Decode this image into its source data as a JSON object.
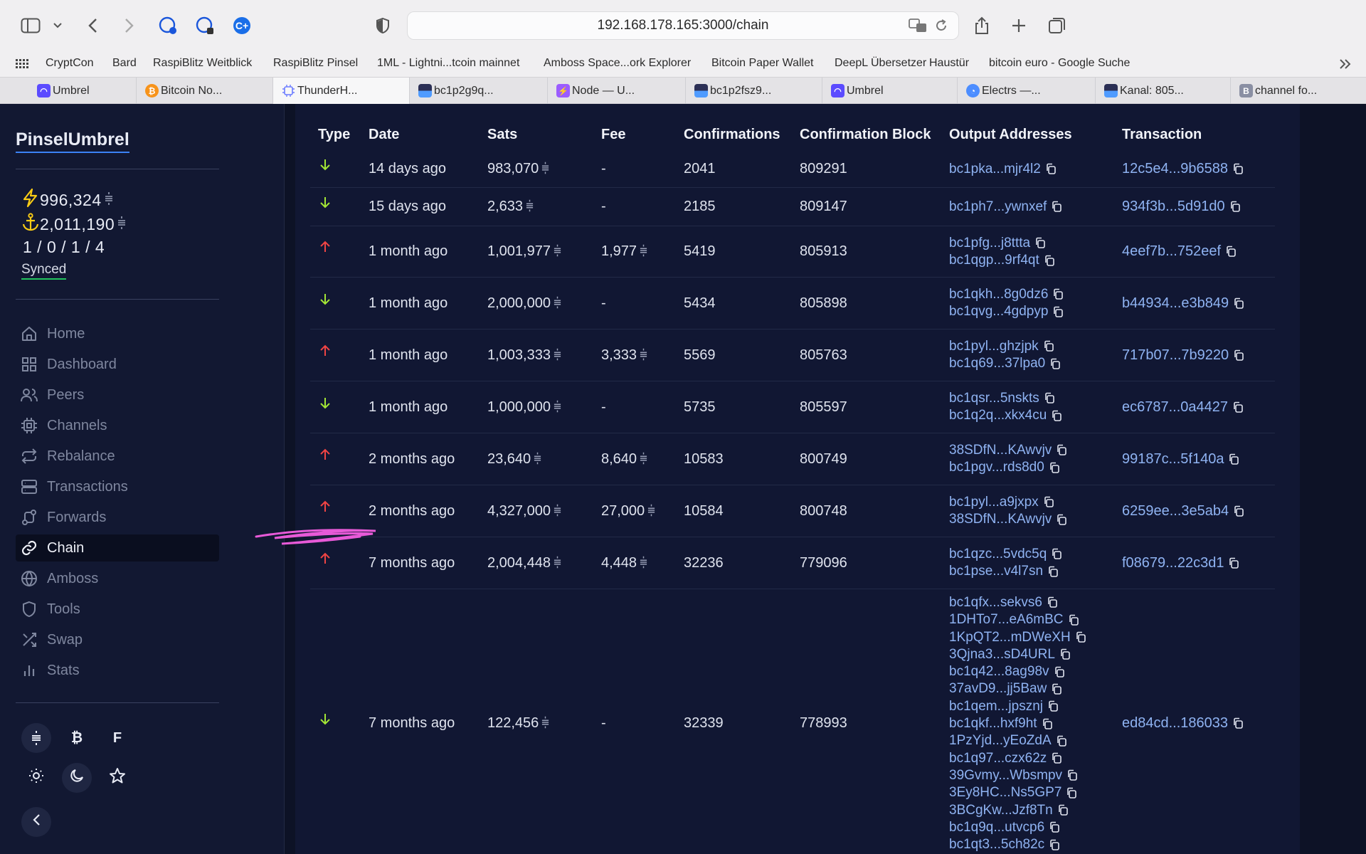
{
  "browser": {
    "url": "192.168.178.165:3000/chain",
    "bookmarks": [
      "CryptCon",
      "Bard",
      "RaspiBlitz Weitblick",
      "RaspiBlitz Pinsel",
      "1ML - Lightni...tcoin mainnet",
      "Amboss Space...ork Explorer",
      "Bitcoin Paper Wallet",
      "DeepL Übersetzer",
      "Haustür",
      "bitcoin euro - Google Suche"
    ],
    "tabs": [
      {
        "label": "Umbrel",
        "icon": "umbrel-icon",
        "color": "#5b4bff"
      },
      {
        "label": "Bitcoin No...",
        "icon": "bitcoin-icon",
        "color": "#f7931a"
      },
      {
        "label": "ThunderH...",
        "icon": "thunderhub-icon",
        "color": "#6b7cff"
      },
      {
        "label": "bc1p2g9q...",
        "icon": "mempool-icon",
        "color": "#3b3f6e"
      },
      {
        "label": "Node — U...",
        "icon": "lightning-icon",
        "color": "#9b5cff"
      },
      {
        "label": "bc1p2fsz9...",
        "icon": "mempool-icon",
        "color": "#3b3f6e"
      },
      {
        "label": "Umbrel",
        "icon": "umbrel-icon",
        "color": "#5b4bff"
      },
      {
        "label": "Electrs —...",
        "icon": "electrs-icon",
        "color": "#4c8dff"
      },
      {
        "label": "Kanal: 805...",
        "icon": "mempool-icon",
        "color": "#3b3f6e"
      },
      {
        "label": "channel fo...",
        "icon": "b-icon",
        "color": "#8a8fa3"
      }
    ]
  },
  "sidebar": {
    "brand": "PinselUmbrel",
    "lightning_balance": "996,324",
    "chain_balance": "2,011,190",
    "channel_counts": "1 / 0 / 1 / 4",
    "sync_status": "Synced",
    "nav": [
      {
        "label": "Home",
        "icon": "home-icon"
      },
      {
        "label": "Dashboard",
        "icon": "dashboard-icon"
      },
      {
        "label": "Peers",
        "icon": "peers-icon"
      },
      {
        "label": "Channels",
        "icon": "channels-icon"
      },
      {
        "label": "Rebalance",
        "icon": "rebalance-icon"
      },
      {
        "label": "Transactions",
        "icon": "transactions-icon"
      },
      {
        "label": "Forwards",
        "icon": "forwards-icon"
      },
      {
        "label": "Chain",
        "icon": "chain-icon",
        "active": true
      },
      {
        "label": "Amboss",
        "icon": "globe-icon"
      },
      {
        "label": "Tools",
        "icon": "shield-icon"
      },
      {
        "label": "Swap",
        "icon": "shuffle-icon"
      },
      {
        "label": "Stats",
        "icon": "bar-chart-icon"
      }
    ],
    "unit_buttons": {
      "sats": "sats",
      "btc": "₿",
      "fiat": "F"
    }
  },
  "table": {
    "headers": {
      "type": "Type",
      "date": "Date",
      "sats": "Sats",
      "fee": "Fee",
      "confirmations": "Confirmations",
      "block": "Confirmation Block",
      "outputs": "Output Addresses",
      "tx": "Transaction"
    },
    "rows": [
      {
        "direction": "in",
        "date": "14 days ago",
        "sats": "983,070",
        "fee": "-",
        "confirmations": "2041",
        "block": "809291",
        "outputs": [
          "bc1pka...mjr4l2"
        ],
        "tx": "12c5e4...9b6588"
      },
      {
        "direction": "in",
        "date": "15 days ago",
        "sats": "2,633",
        "fee": "-",
        "confirmations": "2185",
        "block": "809147",
        "outputs": [
          "bc1ph7...ywnxef"
        ],
        "tx": "934f3b...5d91d0"
      },
      {
        "direction": "out",
        "date": "1 month ago",
        "sats": "1,001,977",
        "fee": "1,977",
        "confirmations": "5419",
        "block": "805913",
        "outputs": [
          "bc1pfg...j8ttta",
          "bc1qgp...9rf4qt"
        ],
        "tx": "4eef7b...752eef"
      },
      {
        "direction": "in",
        "date": "1 month ago",
        "sats": "2,000,000",
        "fee": "-",
        "confirmations": "5434",
        "block": "805898",
        "outputs": [
          "bc1qkh...8g0dz6",
          "bc1qvg...4gdpyp"
        ],
        "tx": "b44934...e3b849"
      },
      {
        "direction": "out",
        "date": "1 month ago",
        "sats": "1,003,333",
        "fee": "3,333",
        "confirmations": "5569",
        "block": "805763",
        "outputs": [
          "bc1pyl...ghzjpk",
          "bc1q69...37lpa0"
        ],
        "tx": "717b07...7b9220"
      },
      {
        "direction": "in",
        "date": "1 month ago",
        "sats": "1,000,000",
        "fee": "-",
        "confirmations": "5735",
        "block": "805597",
        "outputs": [
          "bc1qsr...5nskts",
          "bc1q2q...xkx4cu"
        ],
        "tx": "ec6787...0a4427"
      },
      {
        "direction": "out",
        "date": "2 months ago",
        "sats": "23,640",
        "fee": "8,640",
        "confirmations": "10583",
        "block": "800749",
        "outputs": [
          "38SDfN...KAwvjv",
          "bc1pgv...rds8d0"
        ],
        "tx": "99187c...5f140a"
      },
      {
        "direction": "out",
        "date": "2 months ago",
        "sats": "4,327,000",
        "fee": "27,000",
        "confirmations": "10584",
        "block": "800748",
        "outputs": [
          "bc1pyl...a9jxpx",
          "38SDfN...KAwvjv"
        ],
        "tx": "6259ee...3e5ab4"
      },
      {
        "direction": "out",
        "date": "7 months ago",
        "sats": "2,004,448",
        "fee": "4,448",
        "confirmations": "32236",
        "block": "779096",
        "outputs": [
          "bc1qzc...5vdc5q",
          "bc1pse...v4l7sn"
        ],
        "tx": "f08679...22c3d1"
      },
      {
        "direction": "in",
        "date": "7 months ago",
        "sats": "122,456",
        "fee": "-",
        "confirmations": "32339",
        "block": "778993",
        "outputs": [
          "bc1qfx...sekvs6",
          "1DHTo7...eA6mBC",
          "1KpQT2...mDWeXH",
          "3Qjna3...sD4URL",
          "bc1q42...8ag98v",
          "37avD9...jj5Baw",
          "bc1qem...jpsznj",
          "bc1qkf...hxf9ht",
          "1PzYjd...yEoZdA",
          "bc1q97...czx62z",
          "39Gvmy...Wbsmpv",
          "3Ey8HC...Ns5GP7",
          "3BCgKw...Jzf8Tn",
          "bc1q9q...utvcp6",
          "bc1qt3...5ch82c"
        ],
        "tx": "ed84cd...186033"
      }
    ]
  },
  "colors": {
    "incoming": "#a3e635",
    "outgoing": "#ef4444",
    "link": "#8fb3f2",
    "accent": "#3b82f6",
    "annotation": "#e85ad8"
  }
}
